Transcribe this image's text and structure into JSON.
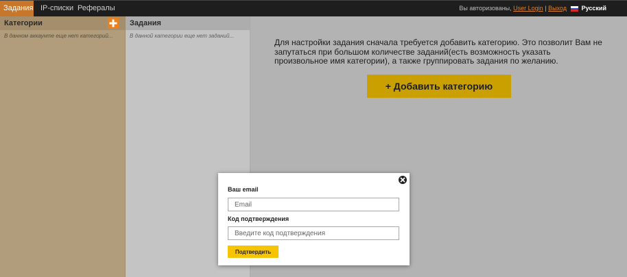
{
  "nav": {
    "tabs": [
      {
        "label": "Задания"
      },
      {
        "label": "IP-списки"
      },
      {
        "label": "Рефералы"
      }
    ],
    "active_tab": 0,
    "auth_text": "Вы авторизованы,",
    "user_link": "User Login",
    "separator": "|",
    "logout_link": "Выход",
    "language": "Русский"
  },
  "categories_panel": {
    "title": "Категории",
    "empty_text": "В данном аккаунте еще нет категорий..."
  },
  "tasks_panel": {
    "title": "Задания",
    "empty_text": "В данной категории еще нет заданий..."
  },
  "main": {
    "info_text": "Для настройки задания сначала требуется добавить категорию. Это позволит Вам не запутаться при большом количестве заданий(есть возможность указать произвольное имя категории), а также группировать задания по желанию.",
    "add_category_label": "+ Добавить категорию"
  },
  "modal": {
    "email_label": "Ваш email",
    "email_placeholder": "Email",
    "code_label": "Код подтверждения",
    "code_placeholder": "Введите код подтверждения",
    "confirm_label": "Подтвердить"
  },
  "colors": {
    "accent": "#c8762a",
    "topbar": "#1e1e1e",
    "categories_bg": "#b19d7b",
    "add_button": "#c9a000",
    "confirm_button": "#f6c400"
  }
}
